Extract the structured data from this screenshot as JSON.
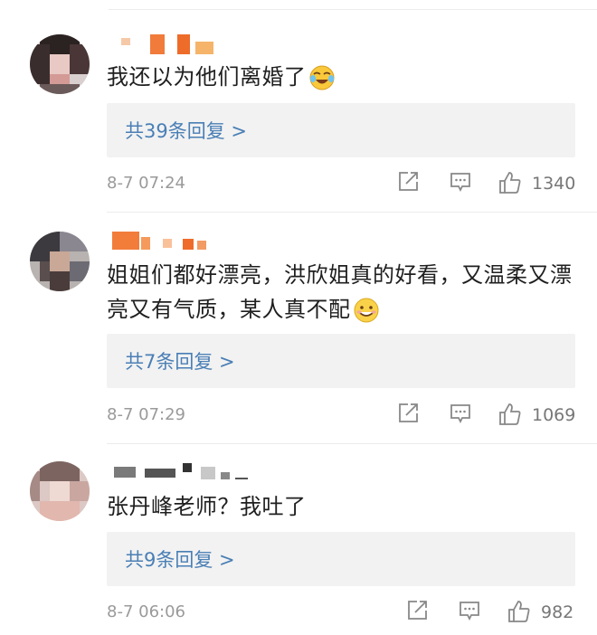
{
  "comments": [
    {
      "text": "我还以为他们离婚了",
      "emoji": "laughing-crying-emoji",
      "replies": "共39条回复 >",
      "time": "8-7 07:24",
      "likes": "1340"
    },
    {
      "text": "姐姐们都好漂亮，洪欣姐真的好看，又温柔又漂亮又有气质，某人真不配",
      "emoji": "grinning-emoji",
      "replies": "共7条回复 >",
      "time": "8-7 07:29",
      "likes": "1069"
    },
    {
      "text": "张丹峰老师？我吐了",
      "replies": "共9条回复 >",
      "time": "8-7 06:06",
      "likes": "982"
    }
  ],
  "icons": {
    "share": "share-icon",
    "comment": "comment-icon",
    "like": "thumbs-up-icon"
  },
  "colors": {
    "link": "#4a7fb5",
    "reply_bg": "#f2f2f2",
    "meta": "#9a9a9a"
  }
}
